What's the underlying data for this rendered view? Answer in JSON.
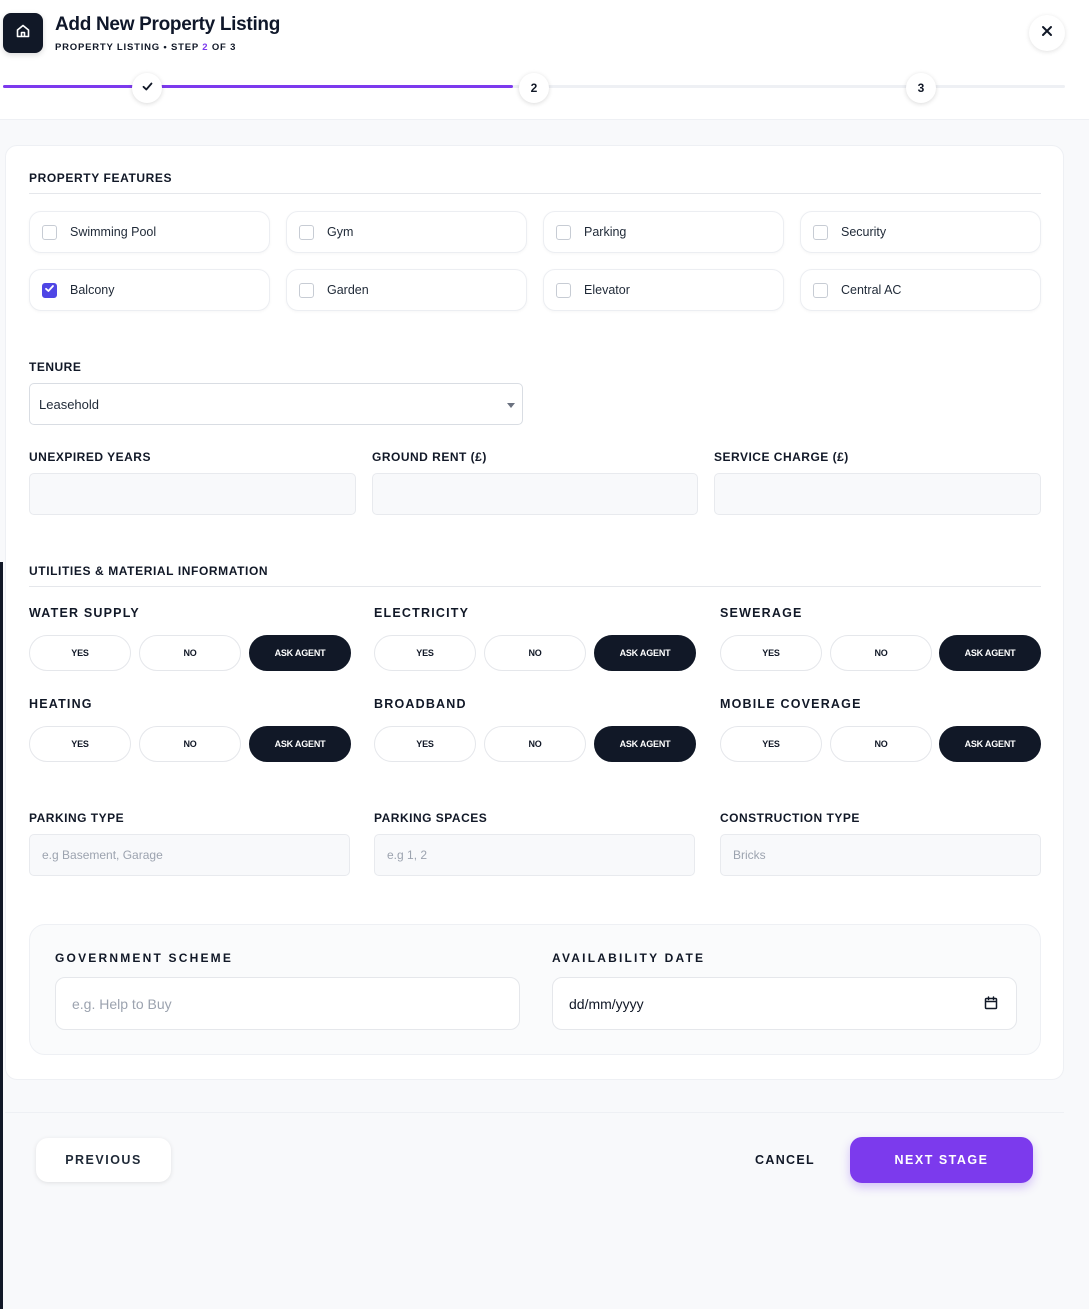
{
  "header": {
    "title": "Add New Property Listing",
    "subtitle_prefix": "PROPERTY LISTING • STEP",
    "current_step": "2",
    "subtitle_suffix": "OF 3",
    "home_icon": "home-icon",
    "close_icon": "close-icon"
  },
  "stepper": {
    "steps": [
      {
        "label": "",
        "state": "done",
        "icon": "check-icon"
      },
      {
        "label": "2",
        "state": "current"
      },
      {
        "label": "3",
        "state": "upcoming"
      }
    ],
    "progress_fraction": 0.48,
    "accent_color": "#7c3aed"
  },
  "features": {
    "title": "PROPERTY FEATURES",
    "items": [
      {
        "label": "Swimming Pool",
        "checked": false
      },
      {
        "label": "Gym",
        "checked": false
      },
      {
        "label": "Parking",
        "checked": false
      },
      {
        "label": "Security",
        "checked": false
      },
      {
        "label": "Balcony",
        "checked": true
      },
      {
        "label": "Garden",
        "checked": false
      },
      {
        "label": "Elevator",
        "checked": false
      },
      {
        "label": "Central AC",
        "checked": false
      }
    ]
  },
  "tenure": {
    "label": "TENURE",
    "value": "Leasehold"
  },
  "lease_fields": [
    {
      "label": "UNEXPIRED YEARS",
      "value": ""
    },
    {
      "label": "GROUND RENT (£)",
      "value": ""
    },
    {
      "label": "SERVICE CHARGE (£)",
      "value": ""
    }
  ],
  "utilities": {
    "title": "UTILITIES & MATERIAL INFORMATION",
    "options": [
      "YES",
      "NO",
      "ASK AGENT"
    ],
    "groups": [
      {
        "label": "WATER SUPPLY",
        "selected": "ASK AGENT"
      },
      {
        "label": "ELECTRICITY",
        "selected": "ASK AGENT"
      },
      {
        "label": "SEWERAGE",
        "selected": "ASK AGENT"
      },
      {
        "label": "HEATING",
        "selected": "ASK AGENT"
      },
      {
        "label": "BROADBAND",
        "selected": "ASK AGENT"
      },
      {
        "label": "MOBILE COVERAGE",
        "selected": "ASK AGENT"
      }
    ]
  },
  "details": [
    {
      "label": "PARKING TYPE",
      "placeholder": "e.g Basement, Garage"
    },
    {
      "label": "PARKING SPACES",
      "placeholder": "e.g 1, 2"
    },
    {
      "label": "CONSTRUCTION TYPE",
      "placeholder": "Bricks"
    }
  ],
  "scheme": {
    "gov_label": "GOVERNMENT SCHEME",
    "gov_placeholder": "e.g. Help to Buy",
    "date_label": "AVAILABILITY DATE",
    "date_value": "dd/mm/yyyy",
    "calendar_icon": "calendar-icon"
  },
  "footer": {
    "previous": "PREVIOUS",
    "cancel": "CANCEL",
    "next": "NEXT STAGE"
  }
}
